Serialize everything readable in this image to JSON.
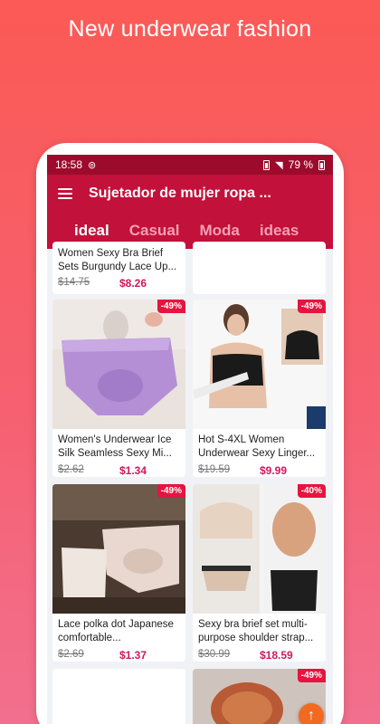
{
  "promo": {
    "title": "New underwear fashion"
  },
  "status_bar": {
    "time": "18:58",
    "battery": "79 %"
  },
  "appbar": {
    "title": "Sujetador de mujer ropa ..."
  },
  "tabs": [
    {
      "label": "ideal",
      "active": true
    },
    {
      "label": "Casual",
      "active": false
    },
    {
      "label": "Moda",
      "active": false
    },
    {
      "label": "ideas",
      "active": false
    }
  ],
  "products": [
    {
      "title": "Women Sexy Bra Brief Sets Burgundy Lace Up...",
      "old_price": "$14.75",
      "price": "$8.26",
      "discount": ""
    },
    {
      "title": "",
      "old_price": "",
      "price": "",
      "discount": ""
    },
    {
      "title": "Women's Underwear Ice Silk Seamless Sexy Mi...",
      "old_price": "$2.62",
      "price": "$1.34",
      "discount": "-49%"
    },
    {
      "title": "Hot S-4XL Women Underwear Sexy Linger...",
      "old_price": "$19.59",
      "price": "$9.99",
      "discount": "-49%"
    },
    {
      "title": "Lace polka dot Japanese comfortable...",
      "old_price": "$2.69",
      "price": "$1.37",
      "discount": "-49%"
    },
    {
      "title": "Sexy bra brief set multi-purpose shoulder strap...",
      "old_price": "$30.99",
      "price": "$18.59",
      "discount": "-40%"
    },
    {
      "title": "",
      "old_price": "",
      "price": "",
      "discount": ""
    },
    {
      "title": "",
      "old_price": "",
      "price": "",
      "discount": "-49%"
    }
  ],
  "colors": {
    "appbar": "#c2113a",
    "status_bar": "#9d0b2c",
    "price": "#d0185a",
    "badge": "#e5153f",
    "fab": "#f26a21"
  },
  "icons": {
    "menu": "menu-icon",
    "sync": "sync-icon",
    "wifi": "wifi-icon",
    "battery": "battery-icon",
    "fab": "arrow-up-icon"
  }
}
